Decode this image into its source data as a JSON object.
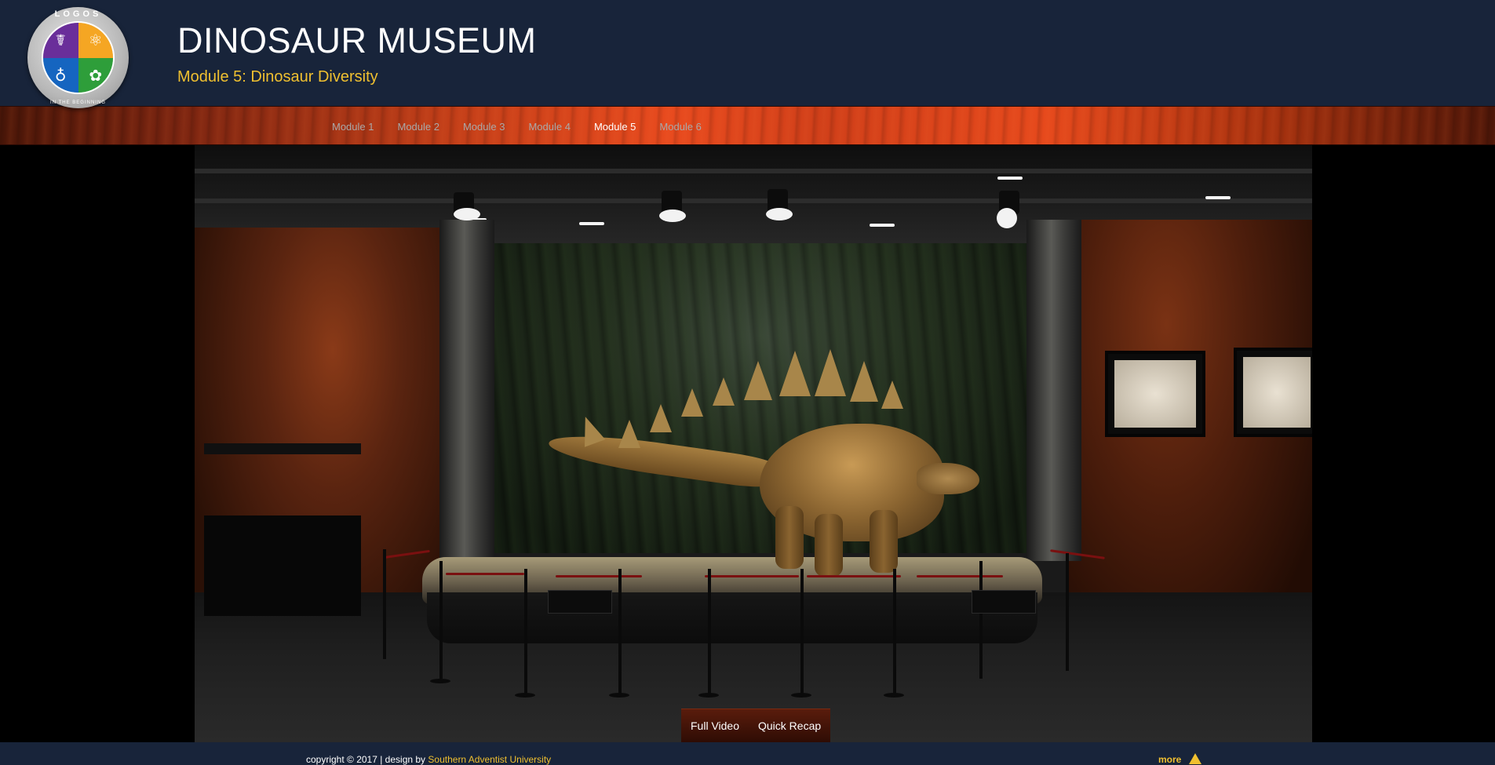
{
  "header": {
    "logo": {
      "ring_text_top": "LOGOS",
      "ring_text_bottom": "IN THE BEGINNING",
      "quadrant_icons": [
        "dna-icon",
        "atom-icon",
        "planet-icon",
        "flower-icon"
      ],
      "quadrant_colors": [
        "#6a2e9a",
        "#f5a623",
        "#1565c0",
        "#2e9e3a"
      ]
    },
    "site_title": "DINOSAUR MUSEUM",
    "module_title": "Module 5: Dinosaur Diversity"
  },
  "nav": {
    "items": [
      {
        "label": "Module 1",
        "active": false
      },
      {
        "label": "Module 2",
        "active": false
      },
      {
        "label": "Module 3",
        "active": false
      },
      {
        "label": "Module 4",
        "active": false
      },
      {
        "label": "Module 5",
        "active": true
      },
      {
        "label": "Module 6",
        "active": false
      }
    ]
  },
  "stage": {
    "scene": "stegosaurus-exhibit",
    "buttons": {
      "full_video": "Full Video",
      "quick_recap": "Quick Recap"
    }
  },
  "footer": {
    "copyright_prefix": "copyright © 2017 | design by",
    "credit": "Southern Adventist University",
    "more": "more"
  },
  "colors": {
    "header_bg": "#18243a",
    "accent_yellow": "#f0c030",
    "nav_wood": "#d03f19",
    "nav_active": "#ffffff",
    "nav_inactive": "#a9a9a9"
  }
}
